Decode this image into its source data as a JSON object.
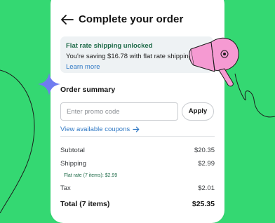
{
  "header": {
    "back_icon": "arrow-left-icon",
    "title": "Complete your order"
  },
  "banner": {
    "title": "Flat rate shipping unlocked",
    "text": "You're saving $16.78 with flat rate shipping!",
    "link": "Learn more"
  },
  "order_summary": {
    "title": "Order summary",
    "promo_placeholder": "Enter promo code",
    "apply_label": "Apply",
    "coupons_link": "View available coupons",
    "rows": [
      {
        "label": "Subtotal",
        "value": "$20.35"
      },
      {
        "label": "Shipping",
        "value": "$2.99"
      },
      {
        "label": "Tax",
        "value": "$2.01"
      }
    ],
    "shipping_note": "Flat rate (7 items): $2.99",
    "total": {
      "label": "Total (7 items)",
      "value": "$25.35"
    }
  },
  "colors": {
    "background": "#34d872",
    "hair_dryer": "#f59ad2",
    "sparkle": "#6f7cf0",
    "link": "#2f78c4",
    "success_text": "#1f6b49"
  },
  "icons": [
    "arrow-left-icon",
    "arrow-right-icon",
    "hair-dryer-illustration",
    "sparkle-icon"
  ]
}
